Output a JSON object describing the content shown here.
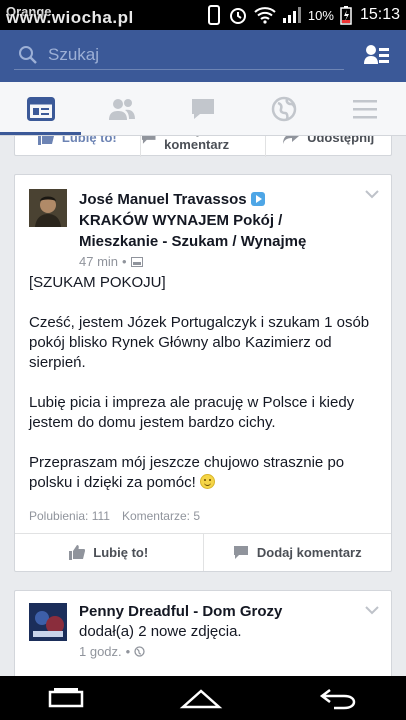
{
  "status_bar": {
    "carrier": "Orange",
    "watermark": "www.wiocha.pl",
    "battery": "10%",
    "time": "15:13"
  },
  "header": {
    "search_placeholder": "Szukaj"
  },
  "nav_tabs": [
    {
      "name": "news-feed",
      "icon": "news-feed-icon",
      "active": true
    },
    {
      "name": "friend-requests",
      "icon": "friends-icon",
      "active": false
    },
    {
      "name": "messages",
      "icon": "message-icon",
      "active": false
    },
    {
      "name": "notifications",
      "icon": "globe-icon",
      "active": false
    },
    {
      "name": "more",
      "icon": "menu-icon",
      "active": false
    }
  ],
  "prev_post_actions": {
    "like": "Lubię to!",
    "comment": "Dodaj komentarz",
    "share": "Udostępnij"
  },
  "post": {
    "author": "José Manuel Travassos",
    "group_line1": "KRAKÓW WYNAJEM Pokój /",
    "group_line2": "Mieszkanie -  Szukam / Wynajmę",
    "time": "47 min",
    "paragraphs": [
      "[SZUKAM POKOJU]",
      "Cześć, jestem Józek Portugalczyk i szukam 1 osób pokój blisko Rynek Główny albo Kazimierz od sierpień.",
      "Lubię picia i impreza ale pracuję w Polsce i kiedy jestem do domu jestem bardzo cichy.",
      "Przepraszam mój jeszcze chujowo strasznie po polsku i dzięki za pomóc!"
    ],
    "likes": "Polubienia: 111",
    "comments": "Komentarze: 5",
    "like_label": "Lubię to!",
    "comment_label": "Dodaj komentarz"
  },
  "post2": {
    "author": "Penny Dreadful - Dom Grozy",
    "action": "dodał(a) 2 nowe zdjęcia.",
    "time": "1 godz."
  },
  "colors": {
    "brand_blue": "#3b5998",
    "feed_bg": "#e9ebee"
  }
}
